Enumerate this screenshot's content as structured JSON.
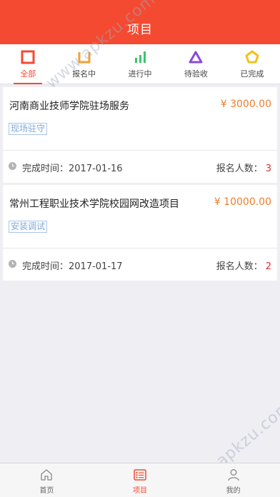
{
  "header": {
    "title": "项目"
  },
  "tabs": [
    {
      "label": "全部",
      "icon": "square-icon",
      "color": "#f44a32"
    },
    {
      "label": "报名中",
      "icon": "tray-icon",
      "color": "#f0a233"
    },
    {
      "label": "进行中",
      "icon": "bars-icon",
      "color": "#3cc46a"
    },
    {
      "label": "待验收",
      "icon": "triangle-icon",
      "color": "#8a4bd8"
    },
    {
      "label": "已完成",
      "icon": "pentagon-icon",
      "color": "#f2c21c"
    }
  ],
  "projects": [
    {
      "title": "河南商业技师学院驻场服务",
      "price": "¥ 3000.00",
      "tag": "现场驻守",
      "date_label": "完成时间：",
      "date": "2017-01-16",
      "count_label": "报名人数：",
      "count": "3"
    },
    {
      "title": "常州工程职业技术学院校园网改造项目",
      "price": "¥ 10000.00",
      "tag": "安装调试",
      "date_label": "完成时间：",
      "date": "2017-01-17",
      "count_label": "报名人数：",
      "count": "2"
    }
  ],
  "watermark": {
    "text1": "www.apkzu.com",
    "text2": "www.apkzu.com"
  },
  "tabbar": [
    {
      "label": "首页",
      "icon": "home-icon"
    },
    {
      "label": "项目",
      "icon": "list-icon"
    },
    {
      "label": "我的",
      "icon": "person-icon"
    }
  ],
  "colors": {
    "accent": "#f44a32",
    "price": "#ef7d2b",
    "count": "#e52b2b"
  }
}
